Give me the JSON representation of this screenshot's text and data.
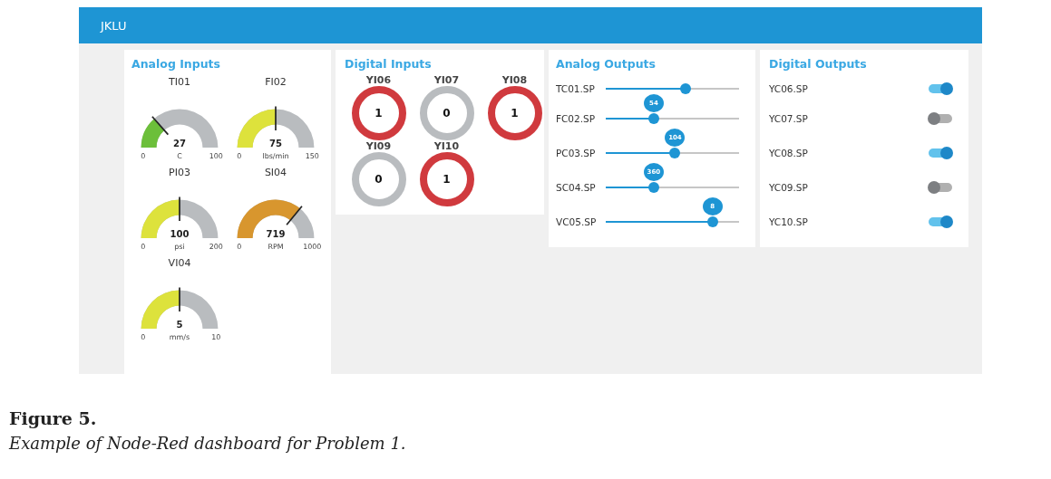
{
  "header": {
    "title": "JKLU"
  },
  "analog_inputs": {
    "title": "Analog Inputs",
    "gauges": [
      {
        "label": "TI01",
        "value": "27",
        "unit": "C",
        "min": "0",
        "max": "100",
        "color": "#6cbf3a"
      },
      {
        "label": "FI02",
        "value": "75",
        "unit": "lbs/min",
        "min": "0",
        "max": "150",
        "color": "#dde23c"
      },
      {
        "label": "PI03",
        "value": "100",
        "unit": "psi",
        "min": "0",
        "max": "200",
        "color": "#dde23c"
      },
      {
        "label": "SI04",
        "value": "719",
        "unit": "RPM",
        "min": "0",
        "max": "1000",
        "color": "#d8962e"
      },
      {
        "label": "VI04",
        "value": "5",
        "unit": "mm/s",
        "min": "0",
        "max": "10",
        "color": "#dde23c"
      }
    ]
  },
  "digital_inputs": {
    "title": "Digital Inputs",
    "indicators": [
      {
        "label": "YI06",
        "value": "1",
        "on": true
      },
      {
        "label": "YI07",
        "value": "0",
        "on": false
      },
      {
        "label": "YI08",
        "value": "1",
        "on": true
      },
      {
        "label": "YI09",
        "value": "0",
        "on": false
      },
      {
        "label": "YI10",
        "value": "1",
        "on": true
      }
    ]
  },
  "analog_outputs": {
    "title": "Analog Outputs",
    "sliders": [
      {
        "label": "TC01.SP",
        "level": 0.6
      },
      {
        "label": "FC02.SP",
        "level": 0.36,
        "tooltip": "54"
      },
      {
        "label": "PC03.SP",
        "level": 0.52,
        "tooltip": "104"
      },
      {
        "label": "SC04.SP",
        "level": 0.36,
        "tooltip": "360"
      },
      {
        "label": "VC05.SP",
        "level": 0.8,
        "tooltip": "8"
      }
    ]
  },
  "digital_outputs": {
    "title": "Digital Outputs",
    "switches": [
      {
        "label": "YC06.SP",
        "on": true
      },
      {
        "label": "YC07.SP",
        "on": false
      },
      {
        "label": "YC08.SP",
        "on": true
      },
      {
        "label": "YC09.SP",
        "on": false
      },
      {
        "label": "YC10.SP",
        "on": true
      }
    ]
  },
  "caption": {
    "title": "Figure 5.",
    "text": "Example of Node-Red dashboard for Problem 1."
  }
}
